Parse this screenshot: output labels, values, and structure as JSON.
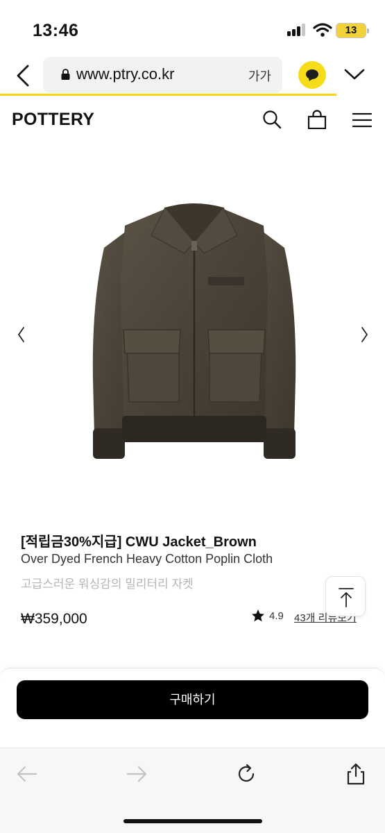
{
  "status_bar": {
    "time": "13:46",
    "battery": "13"
  },
  "browser": {
    "url": "www.ptry.co.kr",
    "text_size": "가가"
  },
  "site": {
    "logo": "POTTERY"
  },
  "product": {
    "title": "[적립금30%지급] CWU Jacket_Brown",
    "subtitle": "Over Dyed French Heavy Cotton Poplin Cloth",
    "description": "고급스러운 워싱감의 밀리터리 자켓",
    "price": "₩359,000",
    "rating": "4.9",
    "reviews_label": "43개 리뷰보기"
  },
  "actions": {
    "buy_label": "구매하기"
  },
  "colors": {
    "accent": "#f7d515",
    "button": "#000000",
    "jacket": "#4a4237"
  }
}
